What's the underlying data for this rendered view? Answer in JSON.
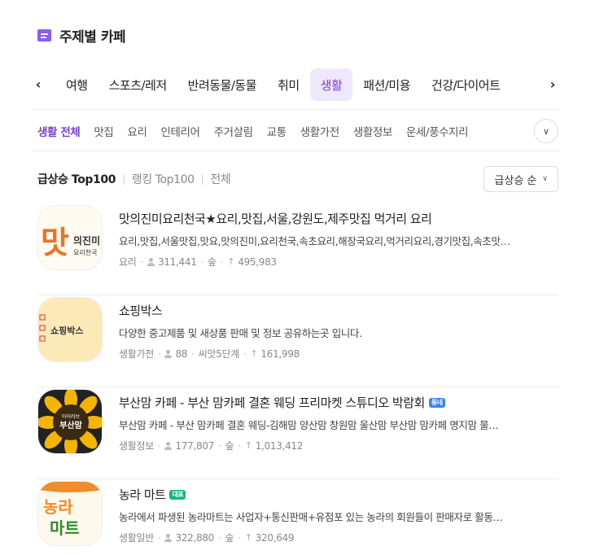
{
  "header": {
    "title": "주제별 카페"
  },
  "categories": {
    "items": [
      "여행",
      "스포츠/레저",
      "반려동물/동물",
      "취미",
      "생활",
      "패션/미용",
      "건강/다이어트"
    ],
    "active_index": 4
  },
  "subcategories": {
    "items": [
      "생활 전체",
      "맛집",
      "요리",
      "인테리어",
      "주거살림",
      "교통",
      "생활가전",
      "생활정보",
      "운세/풍수지리"
    ],
    "active_index": 0
  },
  "ranking": {
    "tabs": [
      "급상승 Top100",
      "랭킹 Top100",
      "전체"
    ],
    "active_index": 0,
    "sort_label": "급상승 순"
  },
  "cafes": [
    {
      "name": "맛의진미요리천국★요리,맛집,서울,강원도,제주맛집 먹거리 요리",
      "badge": "",
      "description": "요리,맛집,서울맛집,맛요,맛의진미,요리천국,속초요리,해장국요리,먹거리요리,경기맛집,속초맛…",
      "category": "요리",
      "members": "311,441",
      "level": "숲",
      "rank_value": "495,983",
      "thumb_text": [
        "맛",
        "의진미",
        "요리천국"
      ]
    },
    {
      "name": "쇼핑박스",
      "badge": "",
      "description": "다양한 중고제품 및 새상품 판매 및 정보 공유하는곳 입니다.",
      "category": "생활가전",
      "members": "88",
      "level": "씨앗5단계",
      "rank_value": "161,998",
      "thumb_text": [
        "쇼핑박스"
      ]
    },
    {
      "name": "부산맘 카페 - 부산 맘카페 결혼 웨딩 프리마켓 스튜디오 박람회",
      "badge": "동네",
      "description": "부산맘 카페 - 부산 맘카페 결혼 웨딩-김해맘 양산맘 창원맘 울산맘 부산맘 맘카페 명지맘 물…",
      "category": "생활정보",
      "members": "177,807",
      "level": "숲",
      "rank_value": "1,013,412",
      "thumb_text": [
        "아이러브",
        "부산맘"
      ]
    },
    {
      "name": "농라 마트",
      "badge": "대표",
      "description": "농라에서 파생된 농라마트는 사업자+통신판매+유점포 있는 농라의 회원들이 판매자로 활동…",
      "category": "생활일반",
      "members": "322,880",
      "level": "숲",
      "rank_value": "320,649",
      "thumb_text": [
        "농라",
        "마트"
      ]
    }
  ],
  "colors": {
    "accent": "#7b3fd8",
    "accent_bg": "#efe7fb",
    "badge_blue": "#3b82f6",
    "badge_green": "#12b886"
  }
}
